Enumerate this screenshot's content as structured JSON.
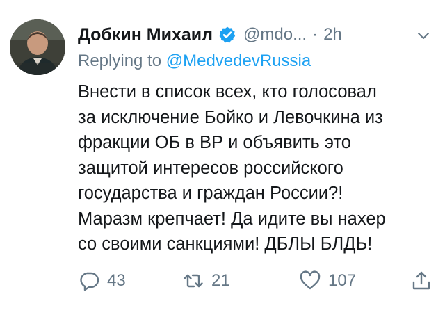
{
  "tweet": {
    "author_name": "Добкин Михаил",
    "handle": "@mdo...",
    "separator": "·",
    "time": "2h",
    "replying_prefix": "Replying to",
    "replying_to": "@MedvedevRussia",
    "text": "Внести в список всех, кто голосовал\nза исключение Бойко и Левочкина из\nфракции ОБ в ВР и объявить это\nзащитой интересов российского\nгосударства и граждан России?!\nМаразм крепчает! Да идите вы нахер\nсо своими санкциями! ДБЛЫ БЛДЬ!",
    "stats": {
      "replies": "43",
      "retweets": "21",
      "likes": "107"
    }
  },
  "icons": {
    "verified": "verified-badge-icon",
    "caret": "chevron-down-icon",
    "reply": "reply-icon",
    "retweet": "retweet-icon",
    "like": "heart-icon",
    "share": "share-icon"
  },
  "colors": {
    "text": "#14171a",
    "secondary": "#657786",
    "link": "#1da1f2",
    "background": "#ffffff"
  }
}
